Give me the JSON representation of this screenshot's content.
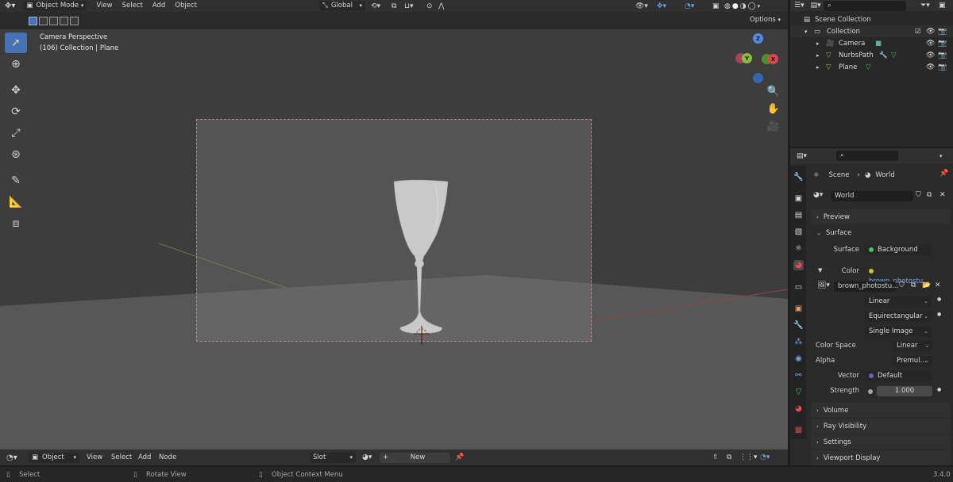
{
  "header": {
    "mode": "Object Mode",
    "menus": [
      "View",
      "Select",
      "Add",
      "Object"
    ],
    "orientation": "Global",
    "options": "Options"
  },
  "viewport": {
    "view_name": "Camera Perspective",
    "context": "(106) Collection | Plane",
    "gizmo": {
      "z": "Z",
      "y": "Y",
      "x": "X"
    }
  },
  "node_header": {
    "editor_mode": "Object",
    "menus": [
      "View",
      "Select",
      "Add",
      "Node"
    ],
    "slot": "Slot",
    "new_label": "New"
  },
  "status": {
    "select": "Select",
    "rotate": "Rotate View",
    "context_menu": "Object Context Menu",
    "version": "3.4.0"
  },
  "outliner": {
    "scene_collection": "Scene Collection",
    "collection": "Collection",
    "items": [
      {
        "name": "Camera",
        "icon": "camera-icon"
      },
      {
        "name": "NurbsPath",
        "icon": "curve-icon"
      },
      {
        "name": "Plane",
        "icon": "mesh-icon"
      }
    ]
  },
  "properties": {
    "breadcrumb_scene": "Scene",
    "breadcrumb_world": "World",
    "world_name": "World",
    "panels": {
      "preview": "Preview",
      "surface": "Surface",
      "volume": "Volume",
      "ray_visibility": "Ray Visibility",
      "settings": "Settings",
      "viewport_display": "Viewport Display"
    },
    "surface_label": "Surface",
    "surface_value": "Background",
    "color_label": "Color",
    "color_value": "brown_photostu...",
    "image_name": "brown_photostu...",
    "interpolation": "Linear",
    "projection": "Equirectangular",
    "source": "Single Image",
    "color_space_label": "Color Space",
    "color_space_value": "Linear",
    "alpha_label": "Alpha",
    "alpha_value": "Premul...",
    "vector_label": "Vector",
    "vector_value": "Default",
    "strength_label": "Strength",
    "strength_value": "1.000"
  },
  "colors": {
    "accent": "#4772b3",
    "x_axis": "#e0454d",
    "y_axis": "#8bbd3c",
    "z_axis": "#4f8de0",
    "socket_yellow": "#c7c729",
    "socket_blue": "#6363c7",
    "socket_gray": "#a1a1a1"
  }
}
